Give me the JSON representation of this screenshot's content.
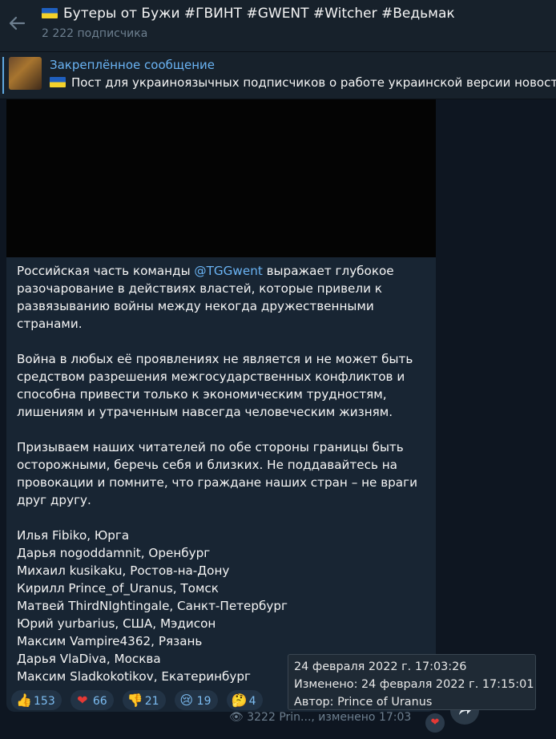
{
  "header": {
    "title": "Бутеры от Бужи #ГВИНТ #GWENT #Witcher #Ведьмак",
    "subscribers": "2 222 подписчика"
  },
  "pinned": {
    "title": "Закреплённое сообщение",
    "text": "Пост для украиноязычных подписчиков о работе украинской версии новостей"
  },
  "message": {
    "p1_before": "Российская часть команды ",
    "p1_link": "@TGGwent",
    "p1_after": " выражает глубокое разочарование в действиях властей, которые привели к развязыванию войны между некогда дружественными странами.",
    "p2": "Война в любых её проявлениях не является и не может быть средством разрешения межгосударственных конфликтов и способна привести только к экономическим трудностям, лишениям и утраченным навсегда человеческим жизням.",
    "p3": "Призываем наших читателей по обе стороны границы быть осторожными, беречь себя и близких. Не поддавайтесь на провокации и помните, что граждане наших стран – не враги друг другу.",
    "signatures": [
      "Илья Fibiko, Юрга",
      "Дарья nogoddamnit, Оренбург",
      "Михаил kusikaku, Ростов-на-Дону",
      "Кирилл Prince_of_Uranus, Томск",
      "Матвей ThirdNIghtingale, Санкт-Петербург",
      "Юрий yurbarius, США, Мэдисон",
      "Максим Vampire4362, Рязань",
      "Дарья VlaDiva, Москва",
      "Максим Sladkokotikov, Екатеринбург"
    ]
  },
  "reactions": [
    {
      "emoji": "👍",
      "count": "153"
    },
    {
      "emoji": "❤",
      "count": "66"
    },
    {
      "emoji": "👎",
      "count": "21"
    },
    {
      "emoji": "😢",
      "count": "19"
    },
    {
      "emoji": "🤔",
      "count": "4"
    }
  ],
  "meta": {
    "views": "3222",
    "author_edited": "Prin..., изменено 17:03"
  },
  "tooltip": {
    "date": "24 февраля 2022 г. 17:03:26",
    "edited": "Изменено: 24 февраля 2022 г. 17:15:01",
    "author": "Автор: Prince of Uranus"
  },
  "colors": {
    "background": "#0e1621",
    "header": "#17212b",
    "bubble": "#182533",
    "accent": "#6ab3f3",
    "muted": "#6d7f8f"
  }
}
